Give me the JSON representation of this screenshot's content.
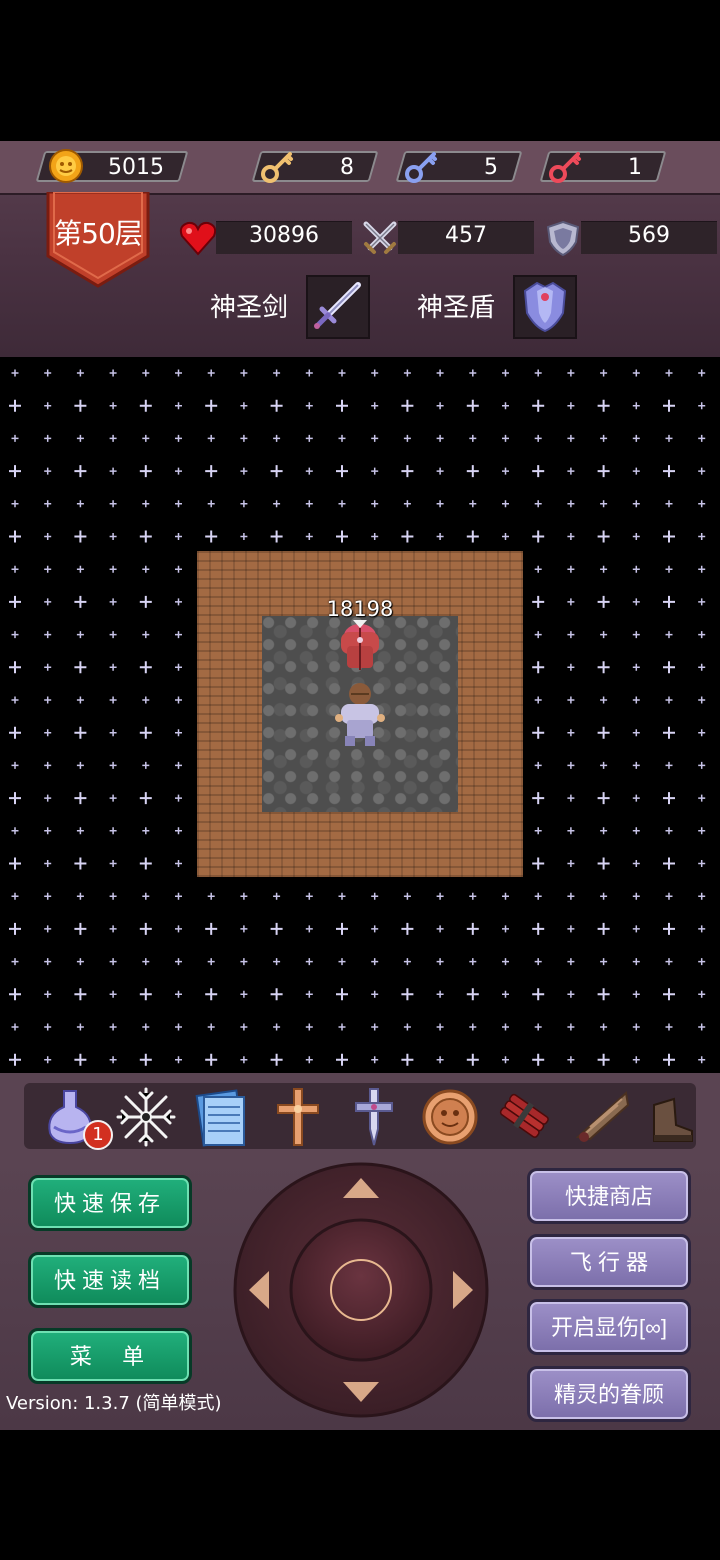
{
  "resources": {
    "gold": "5015",
    "yellow_keys": "8",
    "blue_keys": "5",
    "red_keys": "1"
  },
  "floor": {
    "label": "第50层"
  },
  "stats": {
    "hp": "30896",
    "attack": "457",
    "defense": "569"
  },
  "equipment": {
    "weapon_name": "神圣剑",
    "shield_name": "神圣盾"
  },
  "map": {
    "damage_label": "18198"
  },
  "items": {
    "badge_count": "1",
    "icons": [
      "potion-flask-icon",
      "snowflake-icon",
      "notepad-icon",
      "holy-cross-icon",
      "cross-sword-icon",
      "medallion-icon",
      "dynamite-icon",
      "wing-icon",
      "boot-icon"
    ]
  },
  "buttons": {
    "quick_save": "快速保存",
    "quick_load": "快速读档",
    "menu": "菜  单",
    "quick_shop": "快捷商店",
    "flyer": "飞 行 器",
    "show_damage": "开启显伤[∞]",
    "fairy_favor": "精灵的眷顾"
  },
  "version": "Version: 1.3.7 (简单模式)",
  "colors": {
    "green_button": "#1a9f6e",
    "purple_button": "#8c80bb",
    "floor_banner": "#c0402a"
  }
}
